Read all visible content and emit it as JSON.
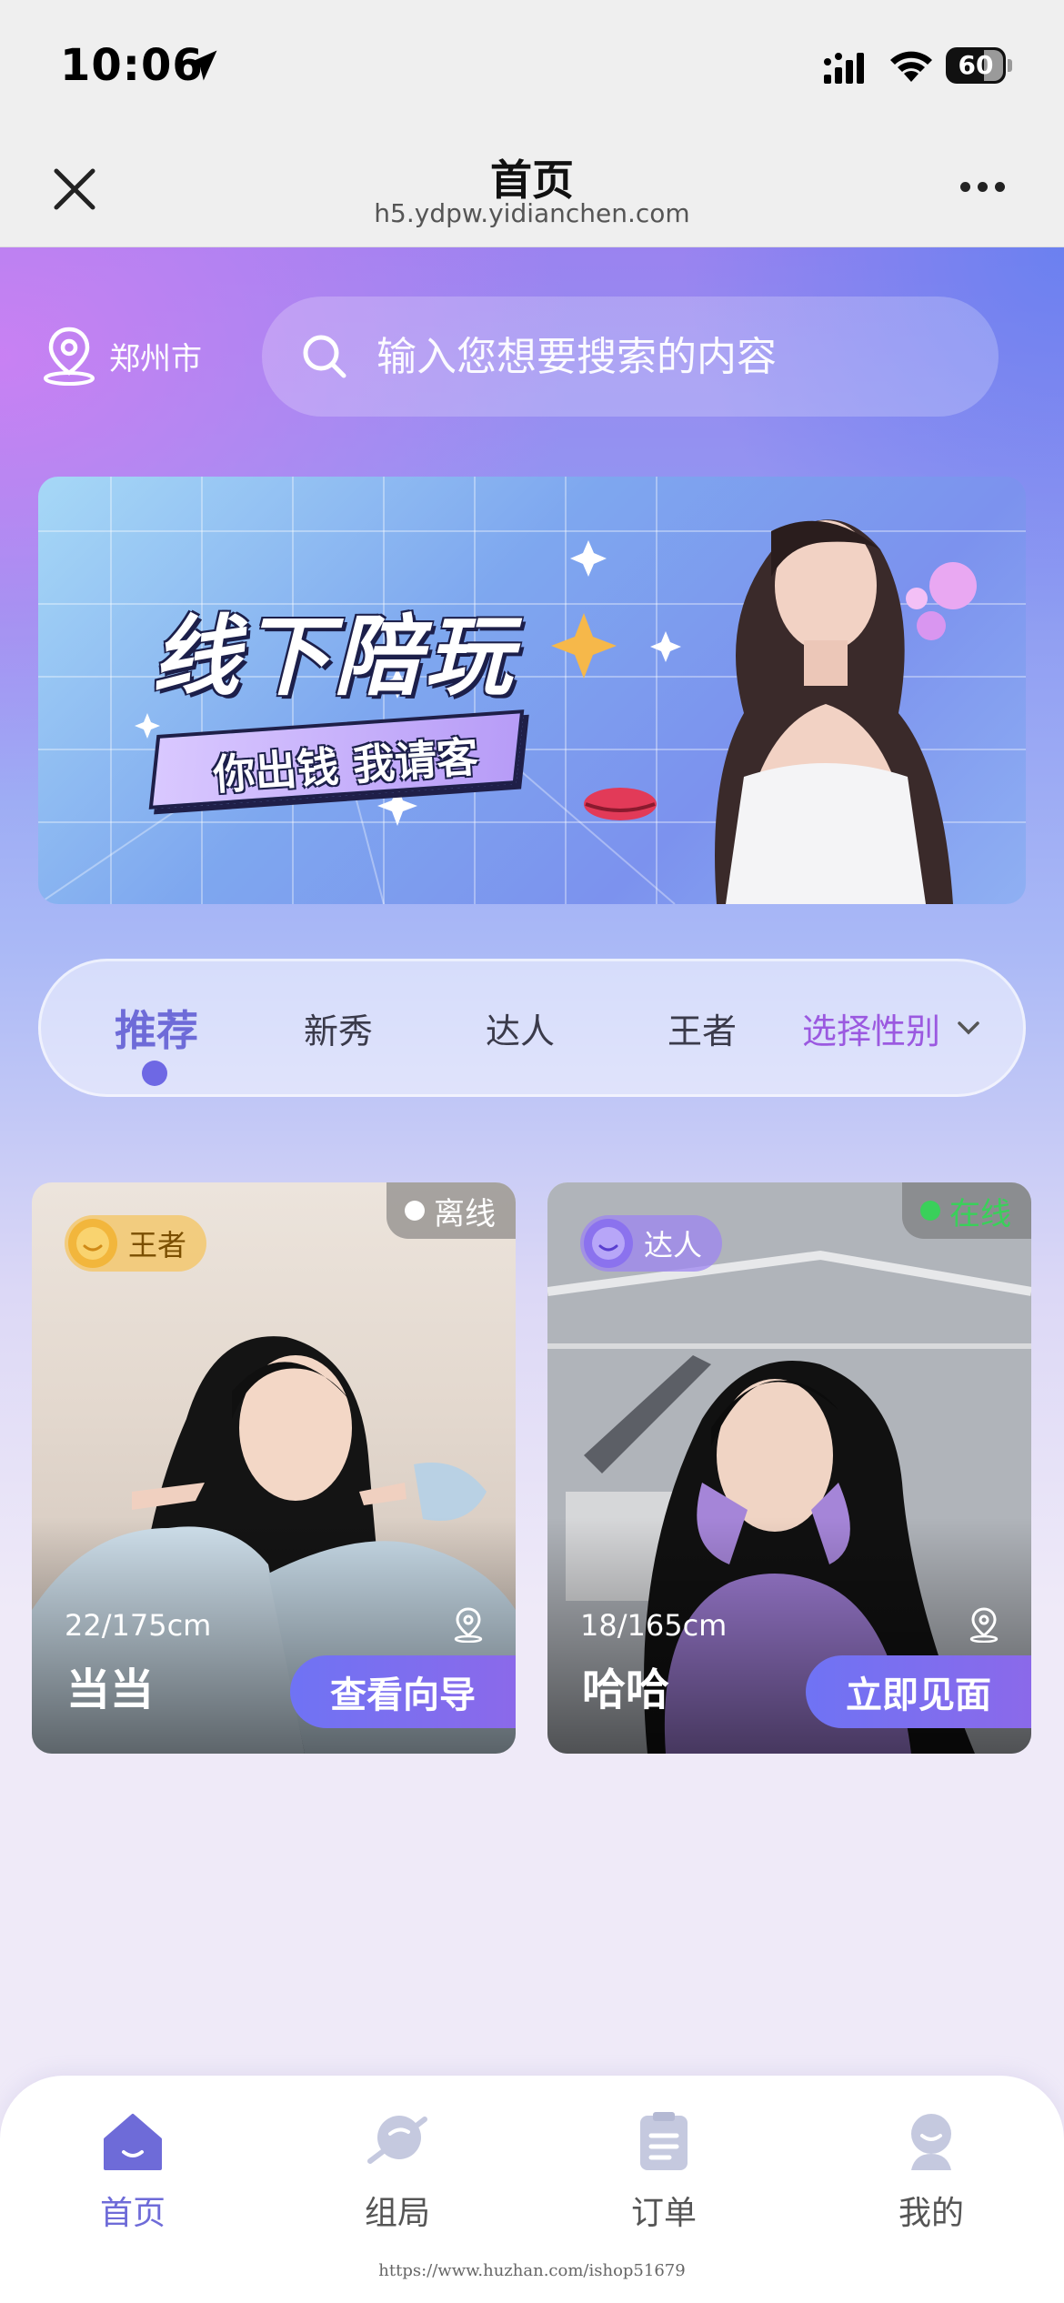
{
  "status_bar": {
    "time": "10:06",
    "battery": "60"
  },
  "nav": {
    "title": "首页",
    "url": "h5.ydpw.yidianchen.com"
  },
  "location": {
    "city": "郑州市"
  },
  "search": {
    "placeholder": "输入您想要搜索的内容"
  },
  "banner": {
    "title": "线下陪玩",
    "subtitle": "你出钱 我请客"
  },
  "tabs": [
    {
      "label": "推荐",
      "active": true
    },
    {
      "label": "新秀",
      "active": false
    },
    {
      "label": "达人",
      "active": false
    },
    {
      "label": "王者",
      "active": false
    }
  ],
  "gender_filter": {
    "label": "选择性别"
  },
  "cards": [
    {
      "name": "当当",
      "stats": "22/175cm",
      "level": "王者",
      "status": "离线",
      "button": "查看向导",
      "status_color": "#ffffff",
      "level_color": "#f0b848"
    },
    {
      "name": "哈哈",
      "stats": "18/165cm",
      "level": "达人",
      "status": "在线",
      "button": "立即见面",
      "status_color": "#3ad05a",
      "level_color": "#9d86f0"
    }
  ],
  "tabbar": [
    {
      "label": "首页",
      "icon": "home-icon",
      "active": true
    },
    {
      "label": "组局",
      "icon": "planet-icon",
      "active": false
    },
    {
      "label": "订单",
      "icon": "clipboard-icon",
      "active": false
    },
    {
      "label": "我的",
      "icon": "user-icon",
      "active": false
    }
  ],
  "watermark": "https://www.huzhan.com/ishop51679",
  "colors": {
    "accent": "#6e6bd8",
    "gender": "#9b59e0",
    "button_start": "#6f73f4",
    "button_end": "#8b69ea"
  }
}
